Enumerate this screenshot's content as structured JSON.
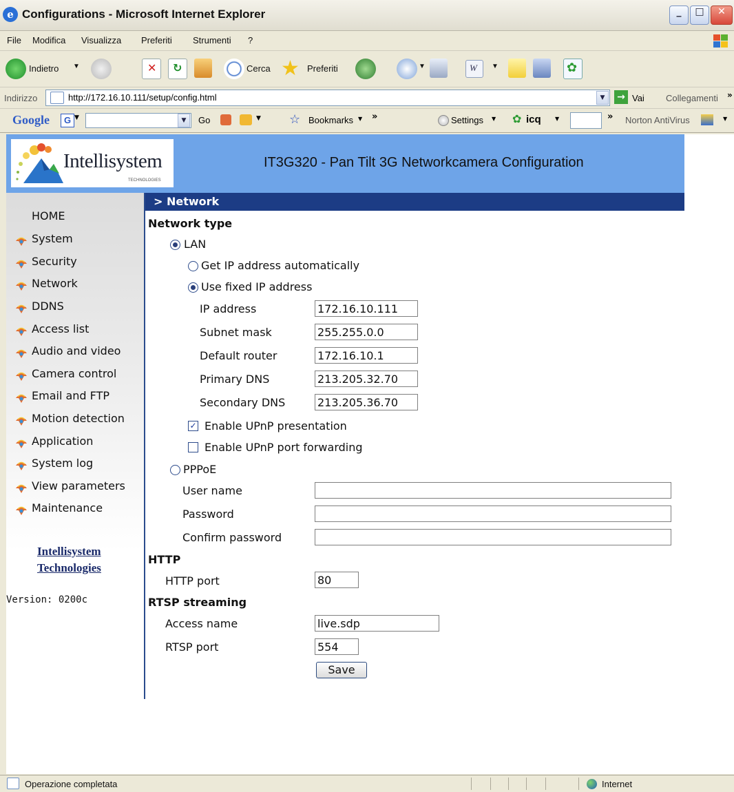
{
  "window": {
    "title": "Configurations - Microsoft Internet Explorer"
  },
  "menu": [
    "File",
    "Modifica",
    "Visualizza",
    "Preferiti",
    "Strumenti",
    "?"
  ],
  "toolbar": {
    "back": "Indietro",
    "search": "Cerca",
    "favorites": "Preferiti"
  },
  "address": {
    "label": "Indirizzo",
    "url": "http://172.16.10.111/setup/config.html",
    "go": "Vai",
    "links": "Collegamenti"
  },
  "googlebar": {
    "logo": "Google",
    "go": "Go",
    "bookmarks": "Bookmarks",
    "settings": "Settings",
    "icq": "icq",
    "norton": "Norton AntiVirus"
  },
  "header": {
    "logo_text": "Intellisystem",
    "logo_sub": "TECHNOLOGIES",
    "title": "IT3G320 - Pan Tilt 3G Networkcamera Configuration"
  },
  "sidebar": {
    "home": "HOME",
    "items": [
      "System",
      "Security",
      "Network",
      "DDNS",
      "Access list",
      "Audio and video",
      "Camera control",
      "Email and FTP",
      "Motion detection",
      "Application",
      "System log",
      "View parameters",
      "Maintenance"
    ],
    "link_line1": "Intellisystem",
    "link_line2": "Technologies",
    "version": "Version: 0200c"
  },
  "section": "> Network",
  "form": {
    "network_type": "Network type",
    "lan": "LAN",
    "lan_selected": true,
    "auto_ip": "Get IP address automatically",
    "fixed_ip": "Use fixed IP address",
    "fixed_ip_selected": true,
    "fields": {
      "ip_label": "IP address",
      "ip_value": "172.16.10.111",
      "subnet_label": "Subnet mask",
      "subnet_value": "255.255.0.0",
      "router_label": "Default router",
      "router_value": "172.16.10.1",
      "dns1_label": "Primary DNS",
      "dns1_value": "213.205.32.70",
      "dns2_label": "Secondary DNS",
      "dns2_value": "213.205.36.70"
    },
    "upnp_presentation": "Enable UPnP presentation",
    "upnp_presentation_checked": true,
    "upnp_forwarding": "Enable UPnP port forwarding",
    "upnp_forwarding_checked": false,
    "pppoe": "PPPoE",
    "user_label": "User name",
    "password_label": "Password",
    "confirm_label": "Confirm password",
    "http": "HTTP",
    "http_port_label": "HTTP port",
    "http_port": "80",
    "rtsp": "RTSP streaming",
    "access_name_label": "Access name",
    "access_name": "live.sdp",
    "rtsp_port_label": "RTSP port",
    "rtsp_port": "554",
    "save": "Save"
  },
  "status": {
    "text": "Operazione completata",
    "zone": "Internet"
  },
  "colors": {
    "header": "#6ea4e8",
    "section_bar": "#1c3c85",
    "divider": "#2a4b8c"
  }
}
